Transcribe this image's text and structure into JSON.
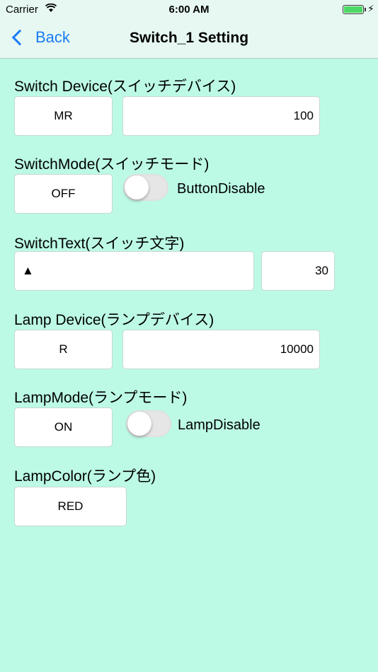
{
  "status_bar": {
    "carrier": "Carrier",
    "time": "6:00 AM"
  },
  "nav": {
    "back_label": "Back",
    "title": "Switch_1 Setting"
  },
  "switch_device": {
    "label": "Switch Device(スイッチデバイス)",
    "type": "MR",
    "value": "100"
  },
  "switch_mode": {
    "label": "SwitchMode(スイッチモード)",
    "value": "OFF",
    "toggle_label": "ButtonDisable",
    "toggle_on": false
  },
  "switch_text": {
    "label": "SwitchText(スイッチ文字)",
    "text": "▲",
    "size": "30"
  },
  "lamp_device": {
    "label": "Lamp Device(ランプデバイス)",
    "type": "R",
    "value": "10000"
  },
  "lamp_mode": {
    "label": "LampMode(ランプモード)",
    "value": "ON",
    "toggle_label": "LampDisable",
    "toggle_on": false
  },
  "lamp_color": {
    "label": "LampColor(ランプ色)",
    "value": "RED"
  },
  "colors": {
    "background": "#bcfae6",
    "accent": "#1a7cf5",
    "battery": "#4cd964"
  }
}
